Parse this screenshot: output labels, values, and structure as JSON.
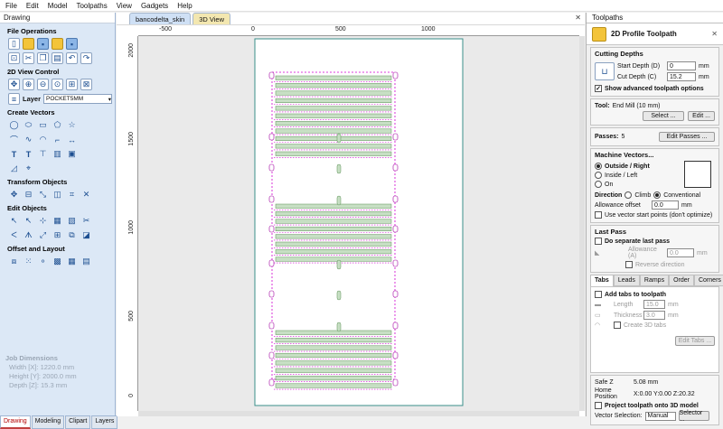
{
  "menu": [
    "File",
    "Edit",
    "Model",
    "Toolpaths",
    "View",
    "Gadgets",
    "Help"
  ],
  "left": {
    "title": "Drawing",
    "sections": {
      "file_ops": "File Operations",
      "view2d": "2D View Control",
      "create_vectors": "Create Vectors",
      "transform": "Transform Objects",
      "edit_objects": "Edit Objects",
      "offset_layout": "Offset and Layout"
    },
    "layer_label": "Layer",
    "layer_value": "POCKET5MM",
    "job": {
      "title": "Job Dimensions",
      "width": "Width  [X]: 1220.0 mm",
      "height": "Height [Y]: 2000.0 mm",
      "depth": "Depth  [Z]: 15.3 mm"
    },
    "tabs": [
      "Drawing",
      "Modeling",
      "Clipart",
      "Layers"
    ]
  },
  "doc_tabs": [
    "bancodelta_skin",
    "3D View"
  ],
  "ruler": {
    "h": [
      "-500",
      "0",
      "500",
      "1000"
    ],
    "v": [
      "2000",
      "1500",
      "1000",
      "500",
      "0"
    ]
  },
  "right": {
    "title": "Toolpaths",
    "heading": "2D Profile Toolpath",
    "cutting_depths": {
      "title": "Cutting Depths",
      "start_label": "Start Depth (D)",
      "start_value": "0",
      "cut_label": "Cut Depth (C)",
      "cut_value": "15.2",
      "unit": "mm",
      "advanced": "Show advanced toolpath options"
    },
    "tool": {
      "label": "Tool:",
      "name": "End Mill (10 mm)",
      "select": "Select ...",
      "edit": "Edit ..."
    },
    "passes": {
      "label": "Passes:",
      "value": "5",
      "edit": "Edit Passes ..."
    },
    "machine": {
      "title": "Machine Vectors...",
      "outside": "Outside / Right",
      "inside": "Inside / Left",
      "on": "On",
      "direction": "Direction",
      "climb": "Climb",
      "conventional": "Conventional",
      "allowance_label": "Allowance offset",
      "allowance_value": "0.0",
      "unit": "mm",
      "start_points": "Use vector start points (don't optimize)"
    },
    "last_pass": {
      "title": "Last Pass",
      "separate": "Do separate last pass",
      "allowance_label": "Allowance (A)",
      "allowance_value": "0.0",
      "unit": "mm",
      "reverse": "Reverse direction"
    },
    "tabs": [
      "Tabs",
      "Leads",
      "Ramps",
      "Order",
      "Corners"
    ],
    "tabs_panel": {
      "add": "Add tabs to toolpath",
      "length_label": "Length",
      "length_value": "15.0",
      "thickness_label": "Thickness",
      "thickness_value": "3.0",
      "unit": "mm",
      "create3d": "Create 3D tabs",
      "edit": "Edit Tabs ..."
    },
    "footer": {
      "safe_z": "Safe Z",
      "safe_z_value": "5.08 mm",
      "home": "Home Position",
      "home_value": "X:0.00 Y:0.00 Z:20.32",
      "project": "Project toolpath onto 3D model",
      "vector_sel": "Vector Selection:",
      "vector_mode": "Manual",
      "selector": "Selector ..."
    }
  }
}
